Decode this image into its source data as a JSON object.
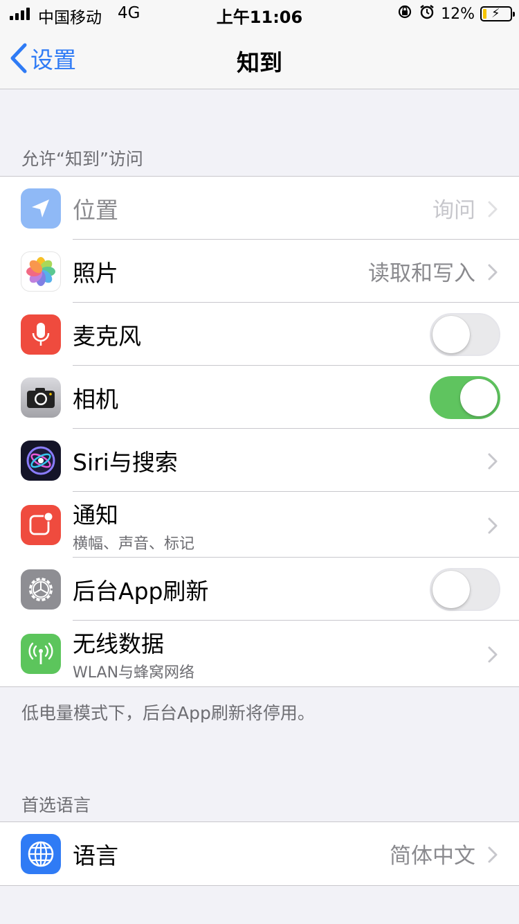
{
  "status_bar": {
    "carrier": "中国移动",
    "network": "4G",
    "time": "上午11:06",
    "battery_percent": "12%",
    "battery_level": 0.12,
    "battery_color": "#f5c400"
  },
  "nav": {
    "back_label": "设置",
    "title": "知到"
  },
  "access_section": {
    "header": "允许“知到”访问",
    "items": [
      {
        "label": "位置",
        "value": "询问",
        "icon": "location-icon",
        "dimmed": true
      },
      {
        "label": "照片",
        "value": "读取和写入",
        "icon": "photos-icon"
      },
      {
        "label": "麦克风",
        "toggle": false,
        "icon": "microphone-icon"
      },
      {
        "label": "相机",
        "toggle": true,
        "icon": "camera-icon"
      },
      {
        "label": "Siri与搜索",
        "icon": "siri-icon"
      },
      {
        "label": "通知",
        "sublabel": "横幅、声音、标记",
        "icon": "notifications-icon"
      },
      {
        "label": "后台App刷新",
        "toggle": false,
        "icon": "gear-icon"
      },
      {
        "label": "无线数据",
        "sublabel": "WLAN与蜂窝网络",
        "icon": "antenna-icon"
      }
    ],
    "footer": "低电量模式下，后台App刷新将停用。"
  },
  "language_section": {
    "header": "首选语言",
    "items": [
      {
        "label": "语言",
        "value": "简体中文",
        "icon": "globe-icon"
      }
    ]
  },
  "colors": {
    "accent": "#2f7bf5",
    "toggle_on": "#5fc45f",
    "background": "#f2f2f7"
  }
}
